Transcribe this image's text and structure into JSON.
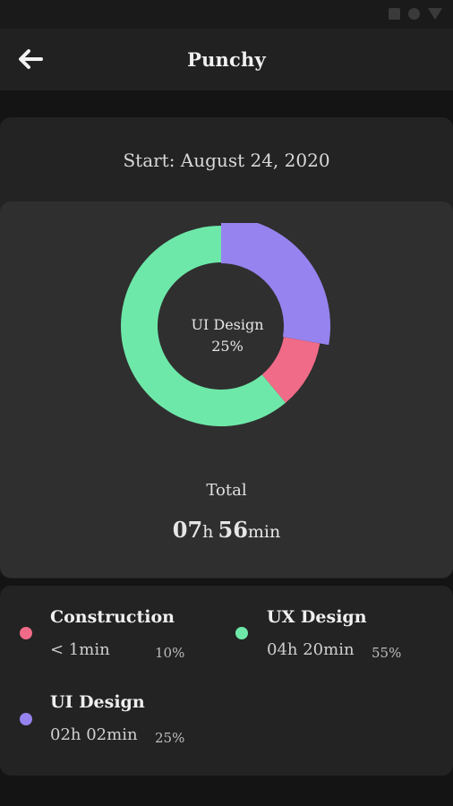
{
  "app": {
    "title": "Punchy"
  },
  "icons": {
    "back": "arrow-left-icon"
  },
  "summary": {
    "start": "Start: August 24, 2020",
    "center_name": "UI Design",
    "center_pct": "25%",
    "total_label": "Total",
    "total_hours": "07",
    "total_hours_unit": "h",
    "total_minutes": "56",
    "total_minutes_unit": "min"
  },
  "colors": {
    "construction": "#f06b88",
    "ux_design": "#6ee8a9",
    "ui_design": "#9683ef"
  },
  "chart_data": {
    "type": "pie",
    "slices": [
      {
        "name": "UI Design",
        "value": 25,
        "color": "#9683ef"
      },
      {
        "name": "Construction",
        "value": 10,
        "color": "#f06b88"
      },
      {
        "name": "UX Design",
        "value": 55,
        "color": "#6ee8a9"
      }
    ]
  },
  "legend": [
    {
      "name": "Construction",
      "time": "< 1min",
      "pct": "10%"
    },
    {
      "name": "UX Design",
      "time": "04h 20min",
      "pct": "55%"
    },
    {
      "name": "UI Design",
      "time": "02h 02min",
      "pct": "25%"
    }
  ]
}
